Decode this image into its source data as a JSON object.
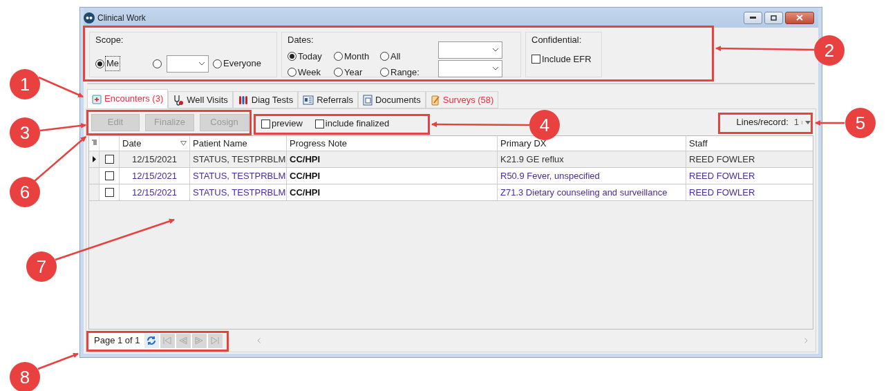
{
  "window": {
    "title": "Clinical Work"
  },
  "scope": {
    "label": "Scope:",
    "options": [
      {
        "kind": "radio",
        "label": "Me",
        "selected": true
      },
      {
        "kind": "combo",
        "selected": false
      },
      {
        "kind": "radio",
        "label": "Everyone",
        "selected": false
      }
    ]
  },
  "dates": {
    "label": "Dates:",
    "options": [
      {
        "label": "Today",
        "selected": true
      },
      {
        "label": "Month",
        "selected": false
      },
      {
        "label": "All",
        "selected": false
      },
      {
        "label": "Week",
        "selected": false
      },
      {
        "label": "Year",
        "selected": false
      },
      {
        "label": "Range:",
        "selected": false
      }
    ]
  },
  "confidential": {
    "label": "Confidential:",
    "checkbox": {
      "label": "Include EFR",
      "checked": false
    }
  },
  "tabs": [
    {
      "label": "Encounters (3)",
      "selected": true,
      "alert": true
    },
    {
      "label": "Well Visits",
      "selected": false,
      "alert": false
    },
    {
      "label": "Diag Tests",
      "selected": false,
      "alert": false
    },
    {
      "label": "Referrals",
      "selected": false,
      "alert": false
    },
    {
      "label": "Documents",
      "selected": false,
      "alert": false
    },
    {
      "label": "Surveys (58)",
      "selected": false,
      "alert": true
    }
  ],
  "toolbar": {
    "buttons": [
      {
        "label": "Edit",
        "disabled": true
      },
      {
        "label": "Finalize",
        "disabled": true
      },
      {
        "label": "Cosign",
        "disabled": true
      }
    ],
    "checkboxes": [
      {
        "label": "preview",
        "checked": false
      },
      {
        "label": "include finalized",
        "checked": false
      }
    ],
    "lines_per_record": {
      "label": "Lines/record:",
      "value": "1"
    }
  },
  "table": {
    "columns": [
      "Date",
      "Patient Name",
      "Progress Note",
      "Primary DX",
      "Staff"
    ],
    "rows": [
      {
        "selected": true,
        "checked": false,
        "cells": [
          "12/15/2021",
          "STATUS, TESTPRBLM",
          "CC/HPI",
          "K21.9 GE reflux",
          "REED FOWLER"
        ]
      },
      {
        "selected": false,
        "checked": false,
        "cells": [
          "12/15/2021",
          "STATUS, TESTPRBLM",
          "CC/HPI",
          "R50.9 Fever, unspecified",
          "REED FOWLER"
        ]
      },
      {
        "selected": false,
        "checked": false,
        "cells": [
          "12/15/2021",
          "STATUS, TESTPRBLM",
          "CC/HPI",
          "Z71.3 Dietary counseling and surveillance",
          "REED FOWLER"
        ]
      }
    ]
  },
  "pager": {
    "text": "Page 1 of 1",
    "buttons": [
      {
        "kind": "refresh",
        "disabled": false
      },
      {
        "kind": "first",
        "disabled": true
      },
      {
        "kind": "prev",
        "disabled": true
      },
      {
        "kind": "next",
        "disabled": true
      },
      {
        "kind": "last",
        "disabled": true
      }
    ]
  },
  "callouts": [
    {
      "label": "1"
    },
    {
      "label": "2"
    },
    {
      "label": "3"
    },
    {
      "label": "4"
    },
    {
      "label": "5"
    },
    {
      "label": "6"
    },
    {
      "label": "7"
    },
    {
      "label": "8"
    }
  ]
}
